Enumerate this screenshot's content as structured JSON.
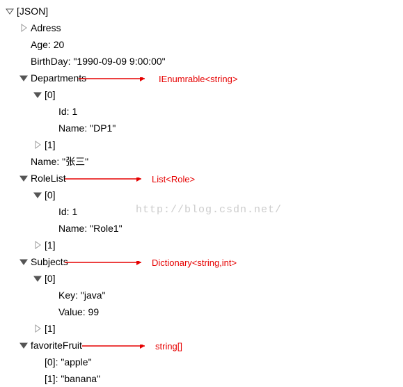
{
  "tree": {
    "root": "[JSON]",
    "adress": "Adress",
    "age": "Age: 20",
    "birthday": "BirthDay: \"1990-09-09 9:00:00\"",
    "departments": {
      "label": "Departments",
      "annotation": "IEnumrable<string>",
      "item0": "[0]",
      "id": "Id: 1",
      "name": "Name: \"DP1\"",
      "item1": "[1]"
    },
    "name": "Name: \"张三\"",
    "rolelist": {
      "label": "RoleList",
      "annotation": "List<Role>",
      "item0": "[0]",
      "id": "Id: 1",
      "name": "Name: \"Role1\"",
      "item1": "[1]"
    },
    "subjects": {
      "label": "Subjects",
      "annotation": "Dictionary<string,int>",
      "item0": "[0]",
      "key": "Key: \"java\"",
      "value": "Value: 99",
      "item1": "[1]"
    },
    "favoritefruit": {
      "label": "favoriteFruit",
      "annotation": "string[]",
      "item0": "[0]: \"apple\"",
      "item1": "[1]: \"banana\""
    }
  },
  "watermark": "http://blog.csdn.net/"
}
